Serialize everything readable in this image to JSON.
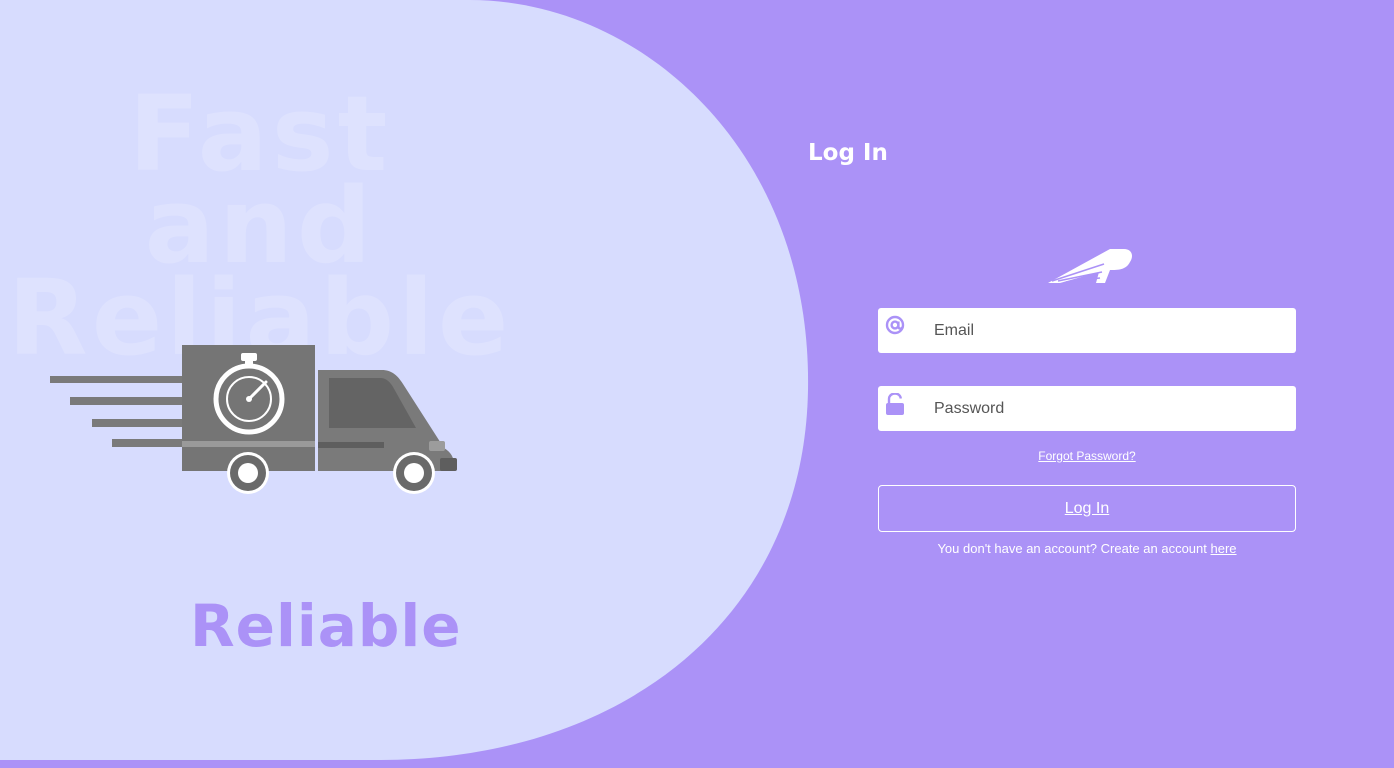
{
  "hero": {
    "watermark_lines": [
      "Fast",
      "and",
      "Reliable"
    ],
    "brand_word": "Reliable"
  },
  "form": {
    "title": "Log In",
    "email": {
      "placeholder": "Email",
      "value": ""
    },
    "password": {
      "placeholder": "Password",
      "value": ""
    },
    "forgot_label": "Forgot Password?",
    "login_label": "Log In",
    "signup_prompt": "You don't have an account? Create an account",
    "signup_link": "here"
  },
  "icons": {
    "email": "at-sign-icon",
    "password": "padlock-icon",
    "logo": "paper-plane-logo-icon",
    "illustration": "delivery-truck-stopwatch-icon"
  },
  "colors": {
    "page_background": "#ab92f7",
    "blob": "#d7dcfe",
    "accent": "#ab92f7",
    "truck": "#7a7a7a",
    "text_light": "#ffffff"
  }
}
